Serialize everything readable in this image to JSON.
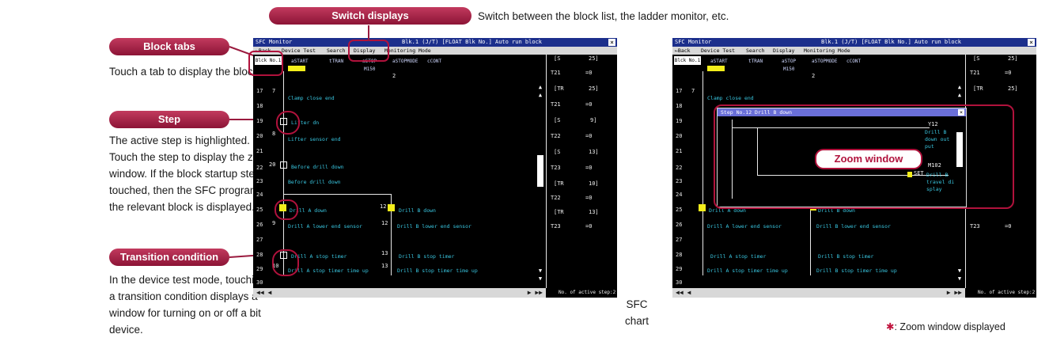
{
  "callouts": {
    "switch_displays": {
      "label": "Switch displays",
      "text": "Switch between the block list, the ladder monitor, etc."
    },
    "block_tabs": {
      "label": "Block tabs",
      "text": "Touch a tab to display the block."
    },
    "step": {
      "label": "Step",
      "lines": [
        "The active step is highlighted.",
        "Touch the step to display the zoom",
        "window.  If the block startup step is",
        "touched, then the SFC program of",
        "the relevant block is displayed."
      ]
    },
    "transition": {
      "label": "Transition condition",
      "lines": [
        "In the device test mode, touching",
        "a transition condition displays a",
        "window for turning on or off a bit",
        "device."
      ]
    }
  },
  "sfc_caption": [
    "SFC",
    "chart"
  ],
  "zoom_callout": "Zoom window",
  "zoom_note": {
    "mark": "✱",
    "text": ": Zoom window displayed"
  },
  "accent_color": "#a3163f",
  "screen_left": {
    "title": "SFC Monitor",
    "title_right": "Blk.1 (J/T) [FLOAT Blk No.]  Auto run block",
    "menu": [
      "←Back",
      "Device Test",
      "Search",
      "Display",
      "Monitoring Mode"
    ],
    "tab": "Blck No.1",
    "headers": [
      "aSTART",
      "tTRAN",
      "aSTOP",
      "aSTOPMODE",
      "cCONT"
    ],
    "sub_value": "M150",
    "sub_num": "2",
    "row_numbers": [
      "17",
      "18",
      "19",
      "20",
      "21",
      "22",
      "23",
      "24",
      "25",
      "26",
      "27",
      "28",
      "29",
      "30"
    ],
    "left_steps": [
      "7",
      "8",
      "20",
      "9",
      "10"
    ],
    "right_steps": [
      "12",
      "12",
      "13",
      "13"
    ],
    "step_labels": [
      "Clamp close end",
      "Lifter dn",
      "Lifter sensor end",
      "Before drill down",
      "Before drill down",
      "Drill A down",
      "Drill A lower end sensor",
      "Drill A stop timer",
      "Drill A stop timer time up"
    ],
    "right_labels": [
      "Drill B down",
      "Drill B lower end sensor",
      "Drill B stop timer",
      "Drill B stop timer time up"
    ],
    "right_panel": [
      [
        "[S",
        "25]"
      ],
      [
        "T21",
        "=0"
      ],
      [
        "[TR",
        "25]"
      ],
      [
        "T21",
        "=0"
      ],
      [
        "[S",
        "9]"
      ],
      [
        "T22",
        "=0"
      ],
      [
        "[S",
        "13]"
      ],
      [
        "T23",
        "=0"
      ],
      [
        "[TR",
        "10]"
      ],
      [
        "T22",
        "=0"
      ],
      [
        "[TR",
        "13]"
      ],
      [
        "T23",
        "=0"
      ]
    ],
    "status": "No. of active step:2"
  },
  "screen_right": {
    "zoom_title": "Step No.12 Drill B down",
    "zoom_labels": [
      "Y12",
      "Drill B",
      "down out",
      "put"
    ],
    "set_label": "SET",
    "set_device": "M102",
    "set_lines": [
      "Drill B",
      "travel di",
      "splay"
    ]
  }
}
